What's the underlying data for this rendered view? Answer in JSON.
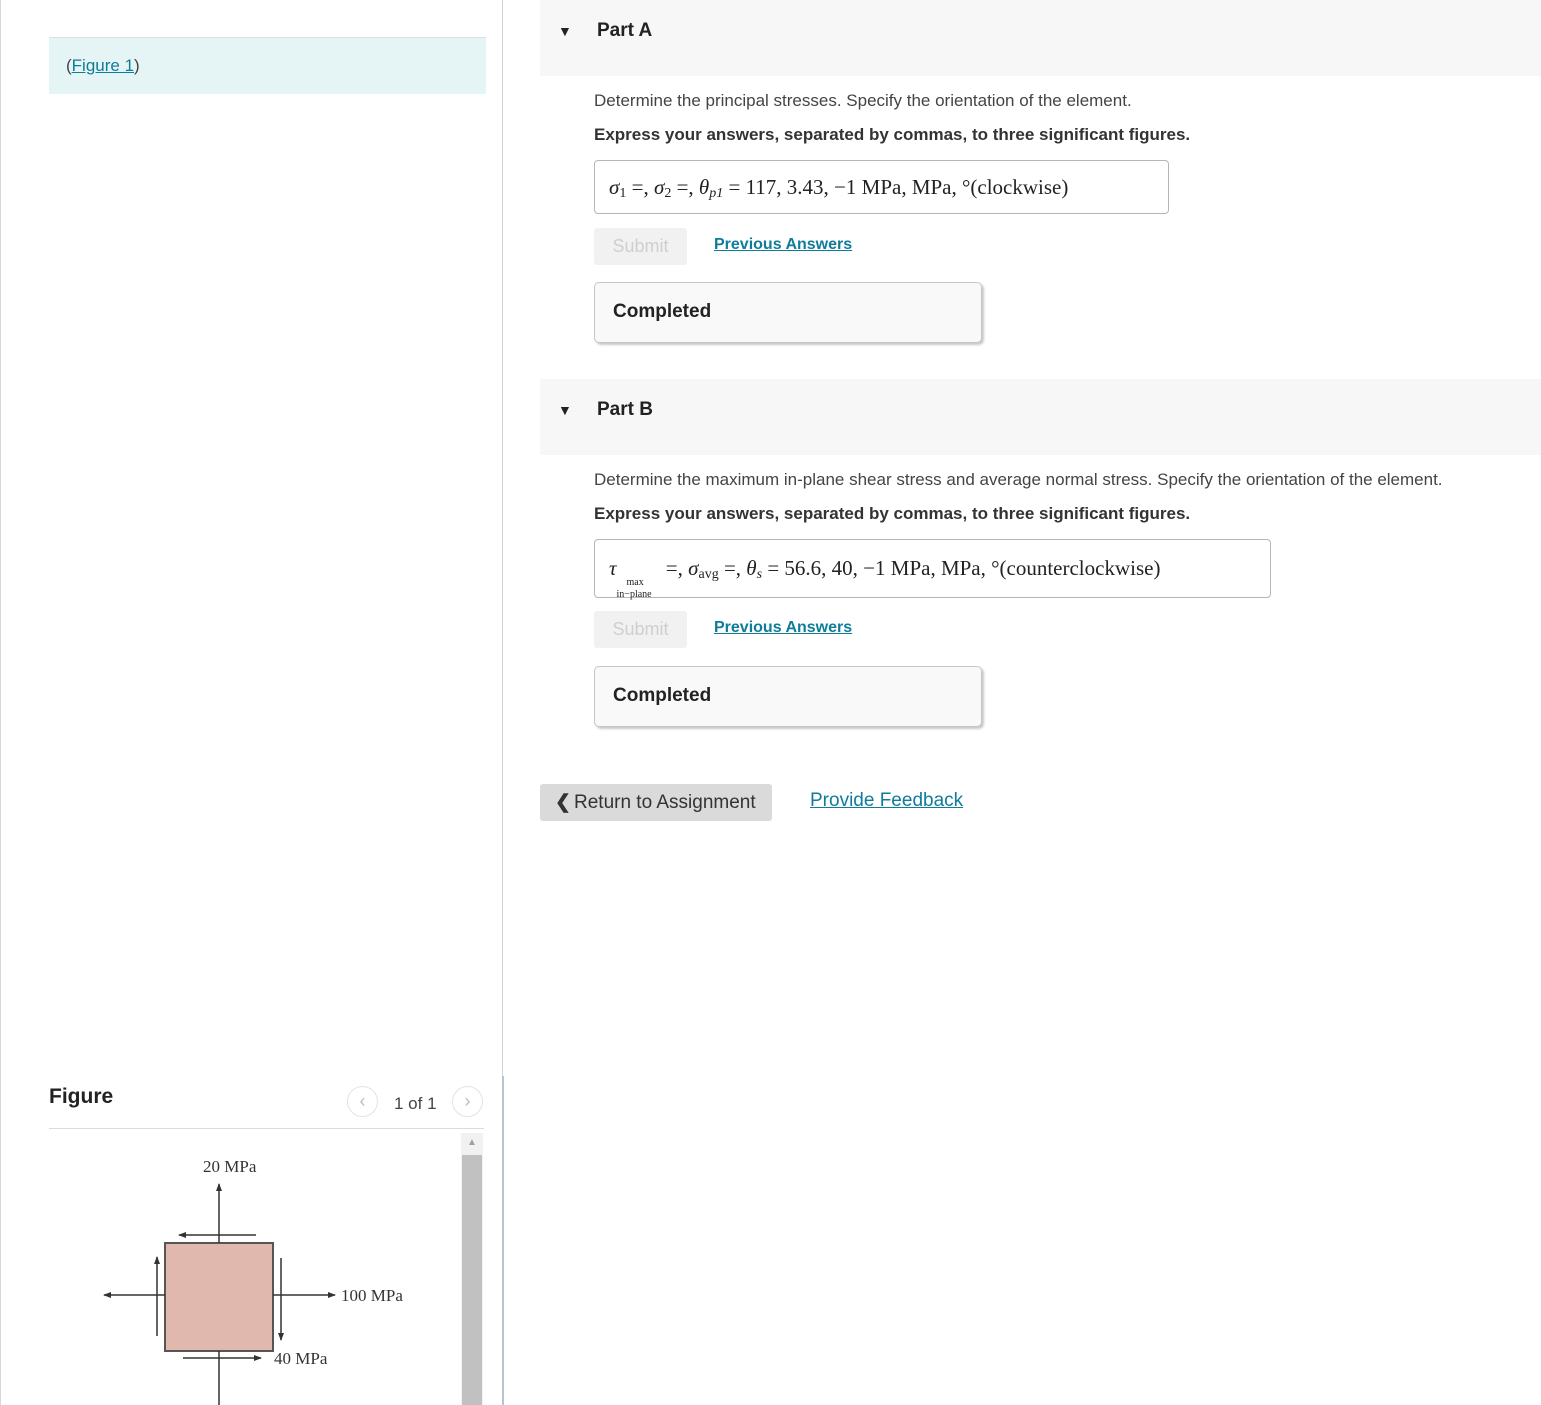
{
  "left_panel": {
    "figure_link": {
      "open_paren": "(",
      "label": "Figure 1",
      "close_paren": ")"
    },
    "figure_viewer": {
      "title": "Figure",
      "prev_icon": "‹",
      "next_icon": "›",
      "page_indicator": "1 of 1",
      "scroll_up_icon": "▲",
      "diagram": {
        "label_top": "20 MPa",
        "label_right": "100 MPa",
        "label_shear": "40 MPa",
        "element_color": "#e0b8ad"
      }
    }
  },
  "parts": [
    {
      "caret_icon": "▼",
      "title": "Part A",
      "question": "Determine the principal stresses. Specify the orientation of the element.",
      "instruction": "Express your answers, separated by commas, to three significant figures.",
      "answer": {
        "s1": "σ",
        "s1_sub": "1",
        "eq1": " =, ",
        "s2": "σ",
        "s2_sub": "2",
        "eq2": " =, ",
        "theta": "θ",
        "theta_sub": "p1",
        "eq3": " =  ",
        "values": "117, 3.43, −1  MPa,  MPa,  °(clockwise)"
      },
      "submit_label": "Submit",
      "previous_answers_label": "Previous Answers",
      "status": "Completed"
    },
    {
      "caret_icon": "▼",
      "title": "Part B",
      "question": "Determine the maximum in-plane shear stress and average normal stress. Specify the orientation of the element.",
      "instruction": "Express your answers, separated by commas, to three significant figures.",
      "answer": {
        "tau": "τ",
        "tau_sup": "max",
        "tau_sub": "in−plane",
        "eq1": " =, ",
        "savg": "σ",
        "savg_sub": "avg",
        "eq2": " =, ",
        "theta": "θ",
        "theta_sub": "s",
        "eq3": " =  ",
        "values": "56.6, 40, −1  MPa,  MPa,  °(counterclockwise)"
      },
      "submit_label": "Submit",
      "previous_answers_label": "Previous Answers",
      "status": "Completed"
    }
  ],
  "footer": {
    "return_icon": "❮",
    "return_label": "Return to Assignment",
    "feedback_label": "Provide Feedback"
  },
  "colors": {
    "link": "#0f7c99",
    "figure_link_bg": "#e5f5f6",
    "part_header_bg": "#f7f7f7"
  }
}
